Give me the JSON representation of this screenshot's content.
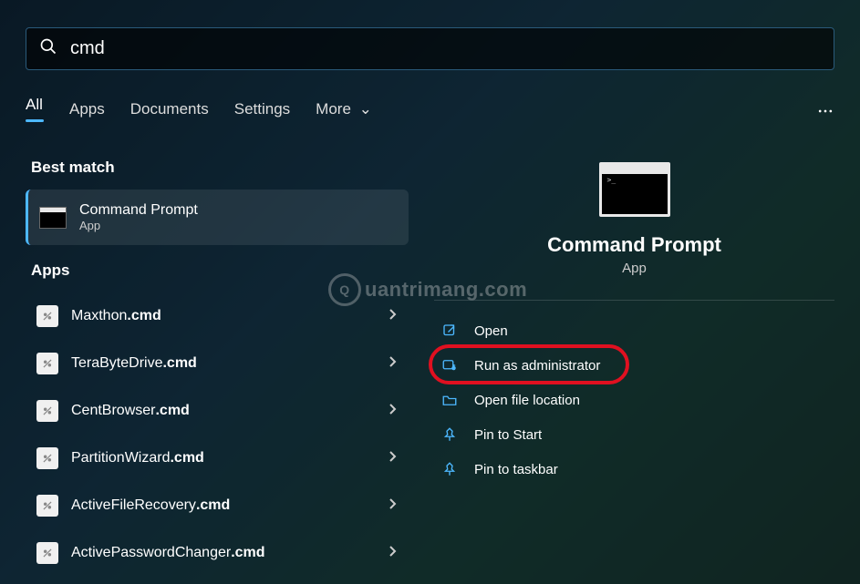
{
  "search": {
    "value": "cmd"
  },
  "tabs": [
    "All",
    "Apps",
    "Documents",
    "Settings",
    "More"
  ],
  "activeTab": 0,
  "sections": {
    "bestMatch": "Best match",
    "apps": "Apps"
  },
  "bestMatch": {
    "title": "Command Prompt",
    "subtitle": "App"
  },
  "appResults": [
    {
      "prefix": "Maxthon",
      "suffix": ".cmd"
    },
    {
      "prefix": "TeraByteDrive",
      "suffix": ".cmd"
    },
    {
      "prefix": "CentBrowser",
      "suffix": ".cmd"
    },
    {
      "prefix": "PartitionWizard",
      "suffix": ".cmd"
    },
    {
      "prefix": "ActiveFileRecovery",
      "suffix": ".cmd"
    },
    {
      "prefix": "ActivePasswordChanger",
      "suffix": ".cmd"
    }
  ],
  "preview": {
    "title": "Command Prompt",
    "subtitle": "App"
  },
  "actions": [
    {
      "id": "open",
      "label": "Open",
      "icon": "open-icon"
    },
    {
      "id": "run-admin",
      "label": "Run as administrator",
      "icon": "admin-icon",
      "highlighted": true
    },
    {
      "id": "open-location",
      "label": "Open file location",
      "icon": "folder-icon"
    },
    {
      "id": "pin-start",
      "label": "Pin to Start",
      "icon": "pin-icon"
    },
    {
      "id": "pin-taskbar",
      "label": "Pin to taskbar",
      "icon": "pin-icon"
    }
  ],
  "watermark": "uantrimang.com"
}
